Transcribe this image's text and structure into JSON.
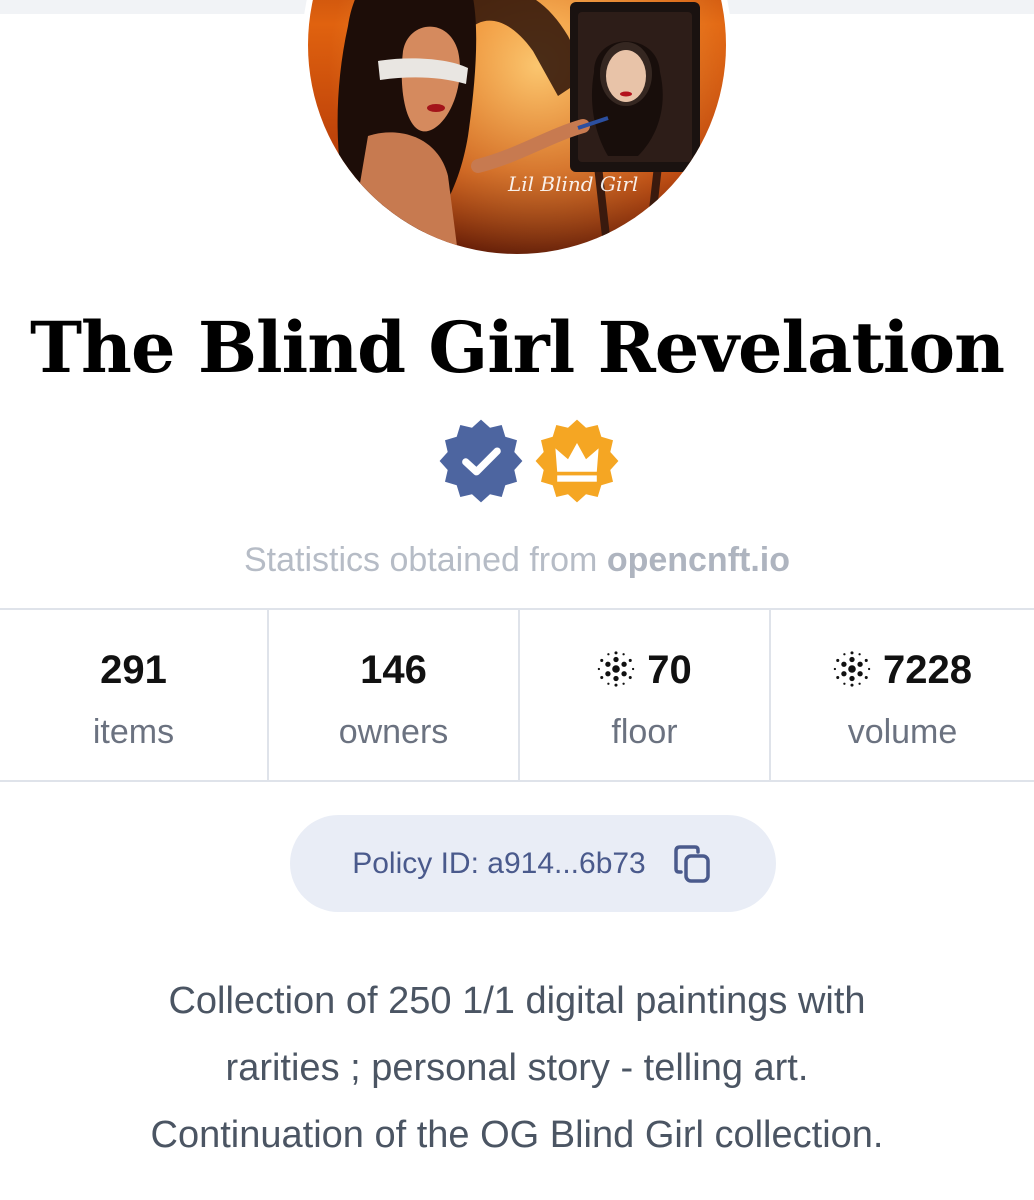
{
  "collection": {
    "title": "The Blind Girl Revelation",
    "badges": [
      {
        "icon": "verified-check-icon",
        "color": "#4d65a0"
      },
      {
        "icon": "crown-icon",
        "color": "#f5a623"
      }
    ],
    "stats_source_prefix": "Statistics obtained from",
    "stats_source_site": "opencnft.io",
    "stats": [
      {
        "value": "291",
        "label": "items",
        "currency_icon": false
      },
      {
        "value": "146",
        "label": "owners",
        "currency_icon": false
      },
      {
        "value": "70",
        "label": "floor",
        "currency_icon": true
      },
      {
        "value": "7228",
        "label": "volume",
        "currency_icon": true
      }
    ],
    "policy_id": "Policy ID: a914...6b73",
    "description_lines": [
      "Collection of 250 1/1 digital paintings with",
      "rarities ; personal story - telling art.",
      "Continuation of the OG Blind Girl collection."
    ],
    "avatar_signature": "Lil Blind Girl"
  }
}
